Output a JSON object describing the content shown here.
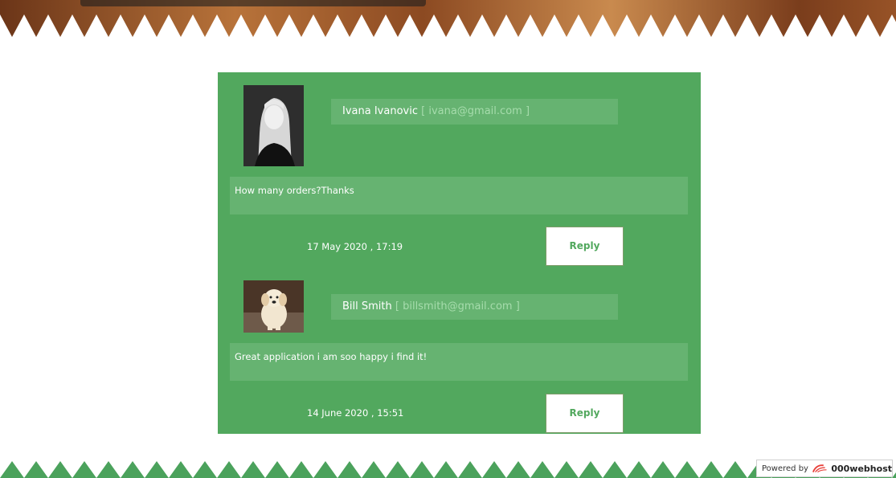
{
  "colors": {
    "panel": "#52a85e",
    "box": "#66b371",
    "email": "#a6dcac",
    "zigzag": "#4ba25c"
  },
  "comments": [
    {
      "author": "Ivana Ivanovic",
      "email_prefix": " [ ",
      "email": "ivana@gmail.com",
      "email_suffix": " ]",
      "message": "How many orders?Thanks",
      "date": "17 May 2020 , 17:19",
      "reply_label": "Reply",
      "avatar_icon": "woman-portrait"
    },
    {
      "author": "Bill Smith",
      "email_prefix": " [ ",
      "email": "billsmith@gmail.com",
      "email_suffix": " ]",
      "message": "Great application i am soo happy i find it!",
      "date": "14 June 2020 , 15:51",
      "reply_label": "Reply",
      "avatar_icon": "puppy-photo"
    }
  ],
  "footer": {
    "powered_by": "Powered by",
    "brand": "000webhost"
  }
}
